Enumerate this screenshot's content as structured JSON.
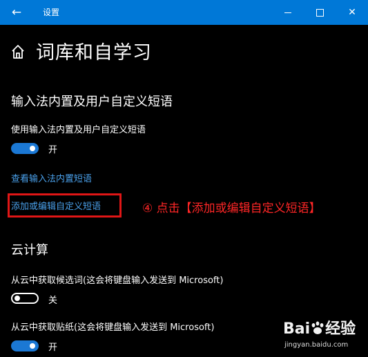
{
  "window": {
    "title": "设置",
    "back_glyph": "←",
    "minimize_icon": "minimize-icon",
    "maximize_icon": "maximize-icon",
    "close_glyph": "✕",
    "accent_color": "#0078d7"
  },
  "page": {
    "title": "词库和自学习",
    "home_icon": "home-icon"
  },
  "builtin_phrases": {
    "heading": "输入法内置及用户自定义短语",
    "toggle_label": "使用输入法内置及用户自定义短语",
    "toggle_state_text": "开",
    "toggle_on": true,
    "view_link": "查看输入法内置短语",
    "edit_link": "添加或编辑自定义短语"
  },
  "annotation": {
    "text": "④ 点击【添加或编辑自定义短语】",
    "color": "#e01616"
  },
  "cloud": {
    "heading": "云计算",
    "candidates_label": "从云中获取候选词(这会将键盘输入发送到 Microsoft)",
    "candidates_state_text": "关",
    "candidates_on": false,
    "stickers_label": "从云中获取贴纸(这会将键盘输入发送到 Microsoft)",
    "stickers_state_text": "开",
    "stickers_on": true
  },
  "watermark": {
    "logo_text_left": "Bai",
    "logo_text_right": "经验",
    "site": "jingyan.baidu.com"
  }
}
